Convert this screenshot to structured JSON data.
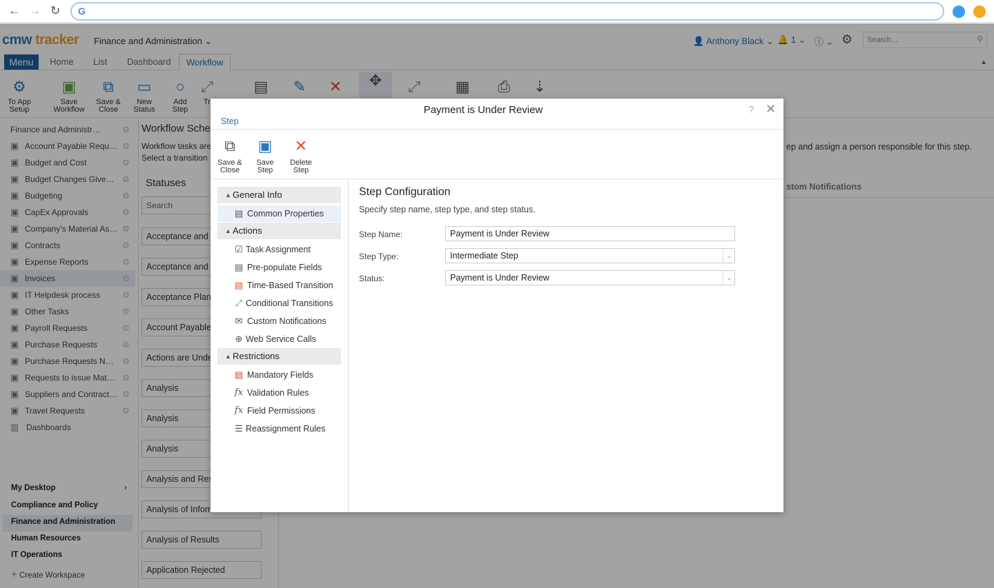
{
  "browser": {
    "address": ""
  },
  "header": {
    "logo_part1": "cmw",
    "logo_part2": "tracker",
    "workspace": "Finance and Administration",
    "user": "Anthony Black",
    "notifications": "1",
    "search_placeholder": "Search..."
  },
  "tabs": {
    "menu": "Menu",
    "items": [
      "Home",
      "List",
      "Dashboard",
      "Workflow"
    ]
  },
  "ribbon": {
    "buttons": [
      {
        "line1": "To App",
        "line2": "Setup"
      },
      {
        "line1": "Save",
        "line2": "Workflow"
      },
      {
        "line1": "Save &",
        "line2": "Close"
      },
      {
        "line1": "New",
        "line2": "Status"
      },
      {
        "line1": "Add",
        "line2": "Step"
      },
      {
        "line1": "Tr",
        "line2": ""
      }
    ]
  },
  "sidebar": {
    "root": "Finance and Administration",
    "items": [
      "Account Payable Reques...",
      "Budget and Cost",
      "Budget Changes GiveBack",
      "Budgeting",
      "CapEx Approvals",
      "Company's Material Ass...",
      "Contracts",
      "Expense Reports",
      "Invoices",
      "IT Helpdesk process",
      "Other Tasks",
      "Payroll Requests",
      "Purchase Requests",
      "Purchase Requests NEW",
      "Requests to issue Mater...",
      "Suppliers and Contractors",
      "Travel Requests"
    ],
    "dashboards": "Dashboards",
    "workspaces": [
      "My Desktop",
      "Compliance and Policy",
      "Finance and Administration",
      "Human Resources",
      "IT Operations"
    ],
    "create": "Create Workspace"
  },
  "content": {
    "title": "Workflow Sche",
    "desc": "Workflow tasks are Select a transition",
    "statuses_heading": "Statuses",
    "search_placeholder": "Search",
    "statuses": [
      "Acceptance and C",
      "Acceptance and C",
      "Acceptance Plan",
      "Account Payable",
      "Actions are Unde",
      "Analysis",
      "Analysis",
      "Analysis",
      "Analysis and Res",
      "Analysis of Information",
      "Analysis of Results",
      "Application Rejected"
    ],
    "right_text": "ep and assign a person responsible for this step.",
    "right_tab": "stom Notifications"
  },
  "dialog": {
    "title": "Payment is Under Review",
    "help": "?",
    "tab": "Step",
    "buttons": [
      {
        "line1": "Save &",
        "line2": "Close"
      },
      {
        "line1": "Save",
        "line2": "Step"
      },
      {
        "line1": "Delete",
        "line2": "Step"
      }
    ],
    "groups": {
      "general": "General Info",
      "actions": "Actions",
      "restrictions": "Restrictions"
    },
    "general_items": [
      "Common Properties"
    ],
    "action_items": [
      "Task Assignment",
      "Pre-populate Fields",
      "Time-Based Transition",
      "Conditional Transitions",
      "Custom Notifications",
      "Web Service Calls"
    ],
    "restriction_items": [
      "Mandatory Fields",
      "Validation Rules",
      "Field Permissions",
      "Reassignment Rules"
    ],
    "config_title": "Step Configuration",
    "config_desc": "Specify step name, step type, and step status.",
    "fields": [
      {
        "label": "Step Name:",
        "value": "Payment is Under Review"
      },
      {
        "label": "Step Type:",
        "value": "Intermediate Step"
      },
      {
        "label": "Status:",
        "value": "Payment is Under Review"
      }
    ]
  }
}
